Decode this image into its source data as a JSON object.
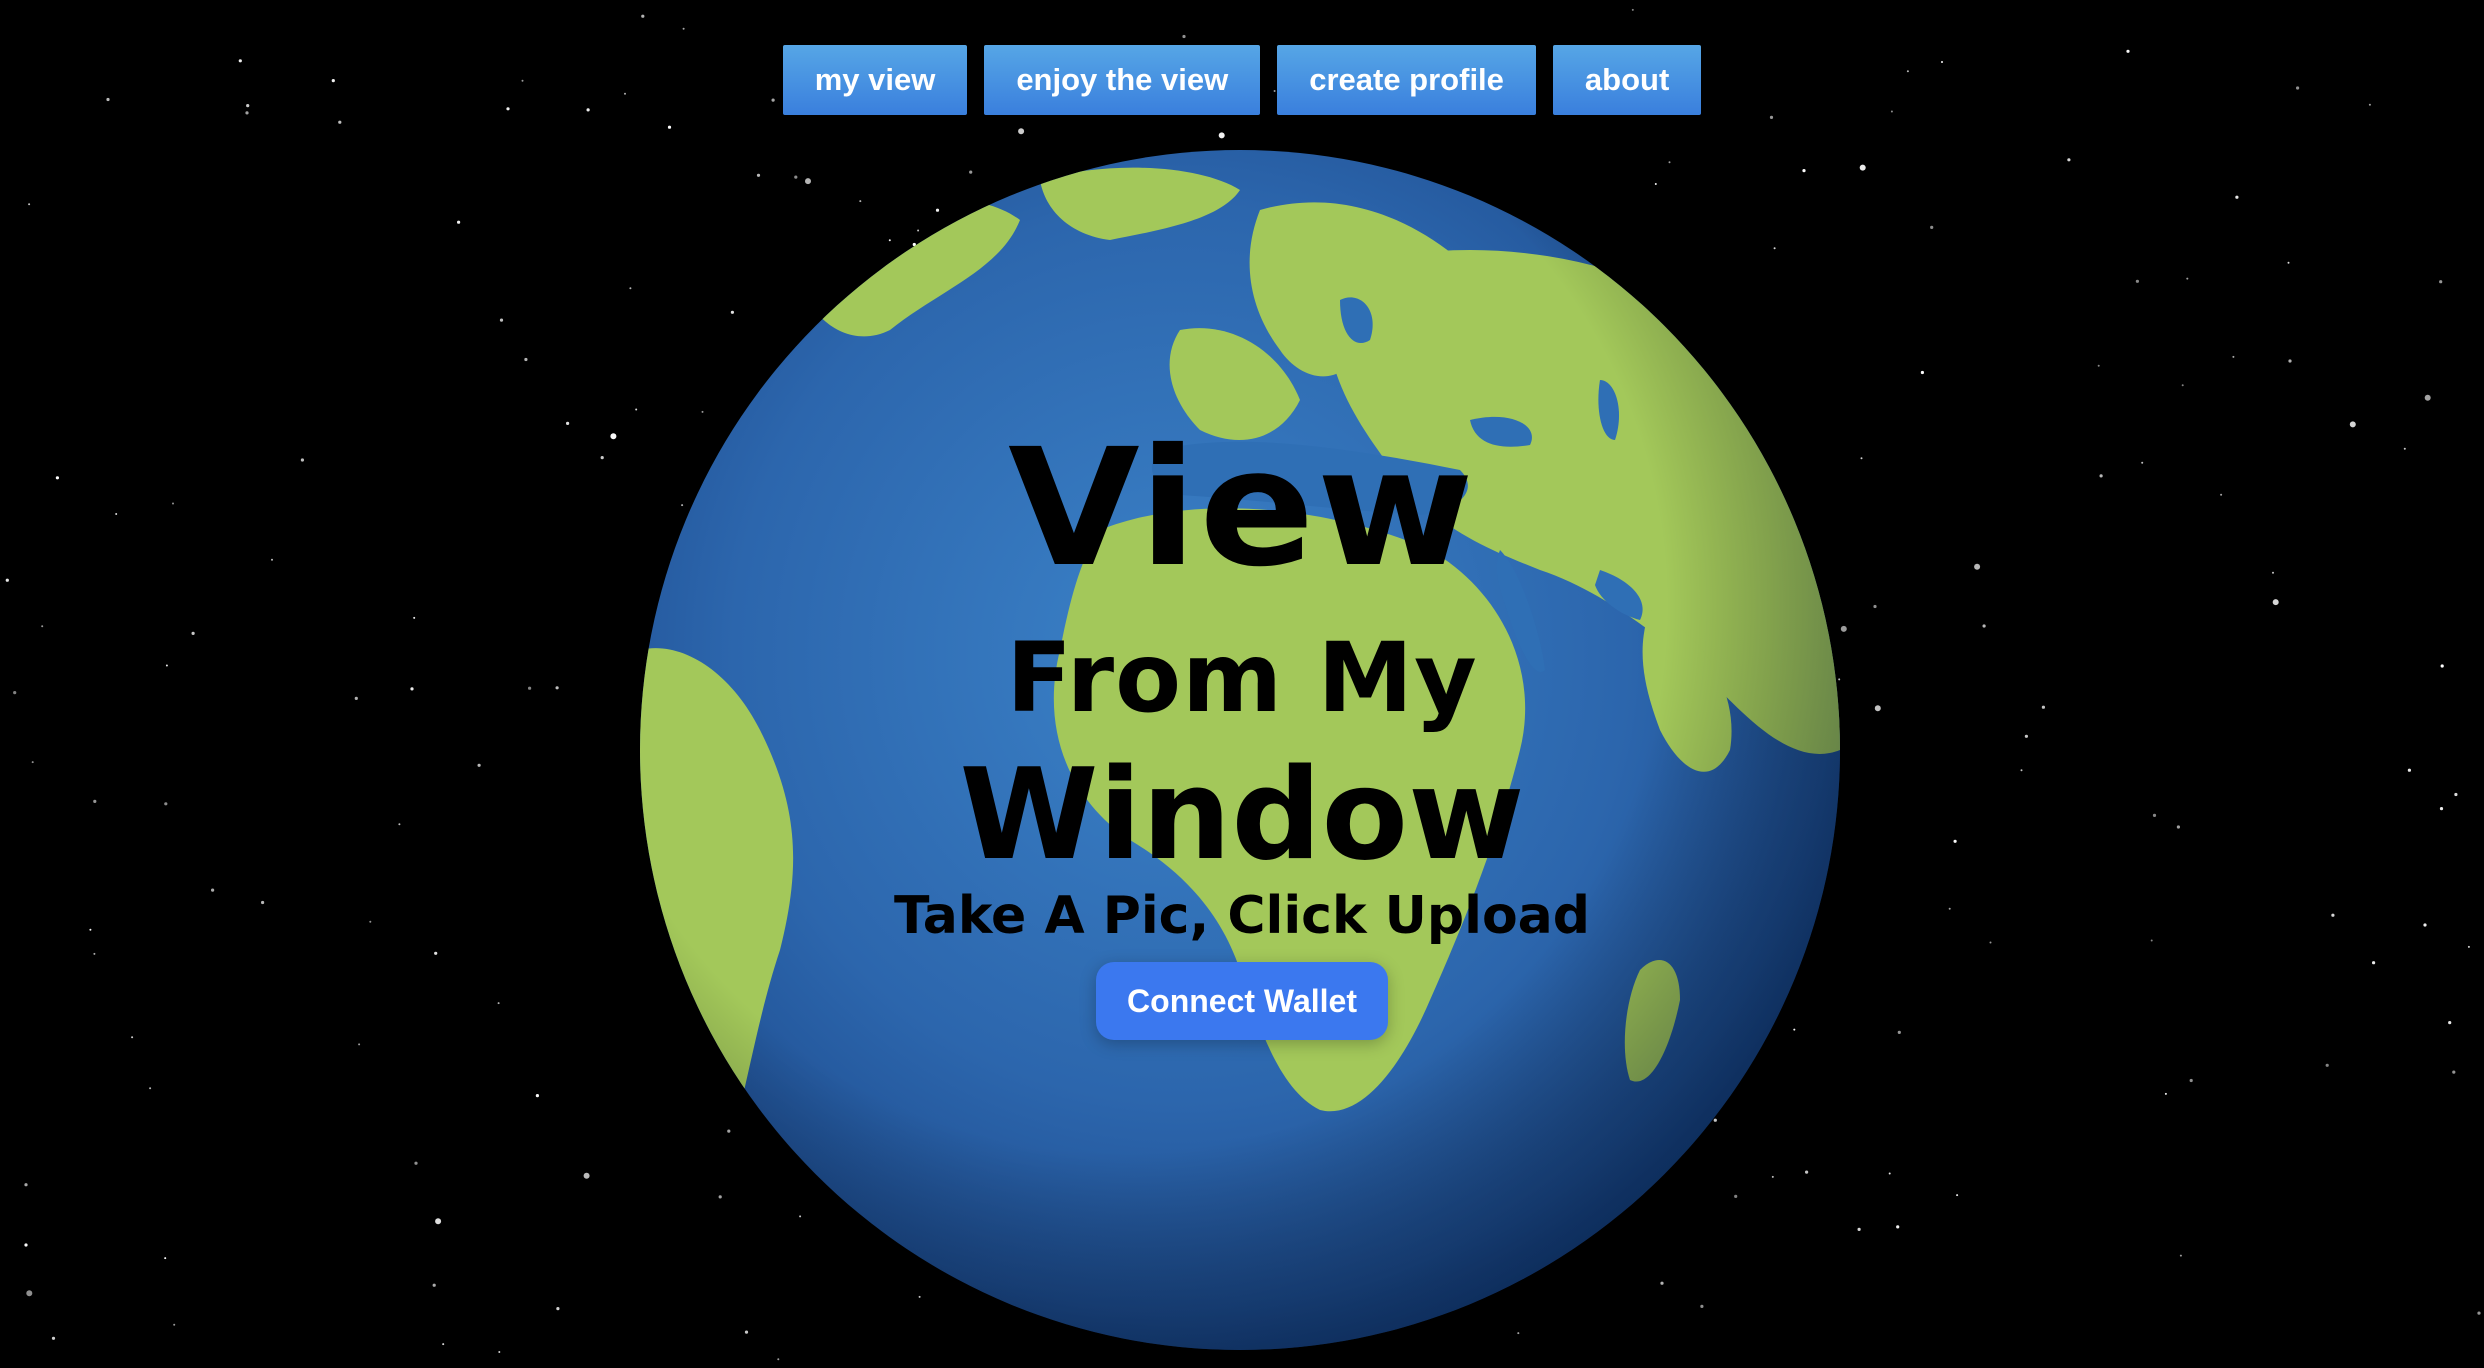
{
  "nav": {
    "items": [
      {
        "label": "my view"
      },
      {
        "label": "enjoy the view"
      },
      {
        "label": "create profile"
      },
      {
        "label": "about"
      }
    ]
  },
  "hero": {
    "title_line1": "View",
    "title_line2": "From My",
    "title_line3": "Window",
    "tagline": "Take A Pic, Click Upload",
    "cta_label": "Connect Wallet"
  },
  "colors": {
    "background": "#000000",
    "nav_button": "#4a90e2",
    "ocean": "#2f6fb5",
    "land": "#a3c85a",
    "cta_button": "#3b78ef",
    "title_text": "#000000"
  },
  "icons": {
    "globe": "earth-globe-illustration",
    "background": "starfield"
  }
}
